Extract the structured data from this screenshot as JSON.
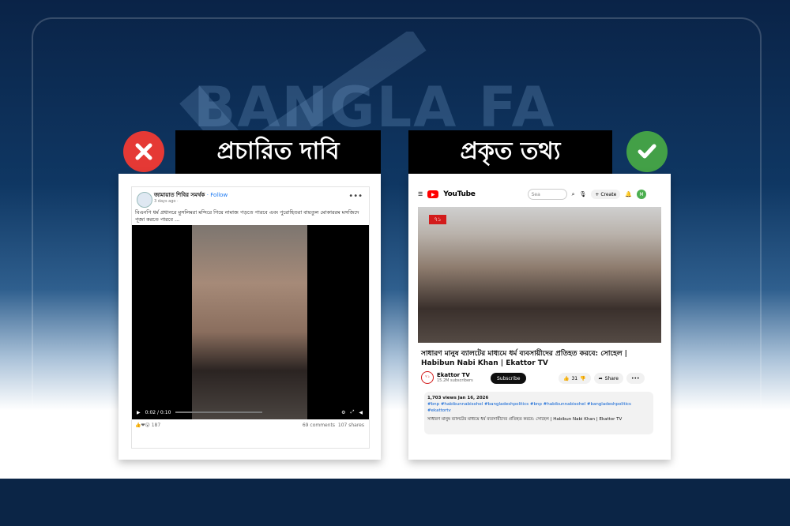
{
  "watermark": {
    "text": "BANGLA FA"
  },
  "left_panel": {
    "label": "প্রচারিত দাবি",
    "badge_icon": "cross-icon",
    "badge_color": "#e53935",
    "post": {
      "page_name": "জামায়াত শিবির সমর্থক",
      "follow_label": "· Follow",
      "time": "3 days ago · ",
      "text": "বিএনপি ধর্ম প্রধানরে মুসলিমরা মন্দিরে গিয়ে নামাজ পড়তে পারবে এবং পুরোহিতরা বায়তুল মোকাররম মসজিদে পূজা করতে পারবে ...",
      "video_time": "0:02 / 0:10",
      "reactions": "187",
      "comments": "69 comments",
      "shares": "107 shares"
    }
  },
  "right_panel": {
    "label": "প্রকৃত তথ্য",
    "badge_icon": "check-icon",
    "badge_color": "#43a047",
    "youtube": {
      "logo_text": "YouTube",
      "search_placeholder": "Sea",
      "create_label": "+ Create",
      "avatar_letter": "M",
      "channel_logo": "৭১",
      "title": "সাধারণ মানুষ ব্যালটের মাধ্যমে ধর্ম ব্যবসায়ীদের প্রতিহত করবে: সোহেল | Habibun Nabi Khan | Ekattor TV",
      "channel_name": "Ekattor TV",
      "subscribers": "15.2M subscribers",
      "subscribe_label": "Subscribe",
      "likes": "31",
      "share_label": "Share",
      "desc_meta": "1,703 views  Jan 16, 2026",
      "hashtags": "#bnp #habibunnabisohel #bangladeshpolitics #bnp #habibunnabisohel #bangladeshpolitics #ekattortv",
      "desc_text": "সাধারণ মানুষ ব্যালটের মাধ্যমে ধর্ম ব্যবসায়ীদের প্রতিহত করবে: সোহেল | Habibun Nabi Khan | Ekattor TV"
    }
  }
}
